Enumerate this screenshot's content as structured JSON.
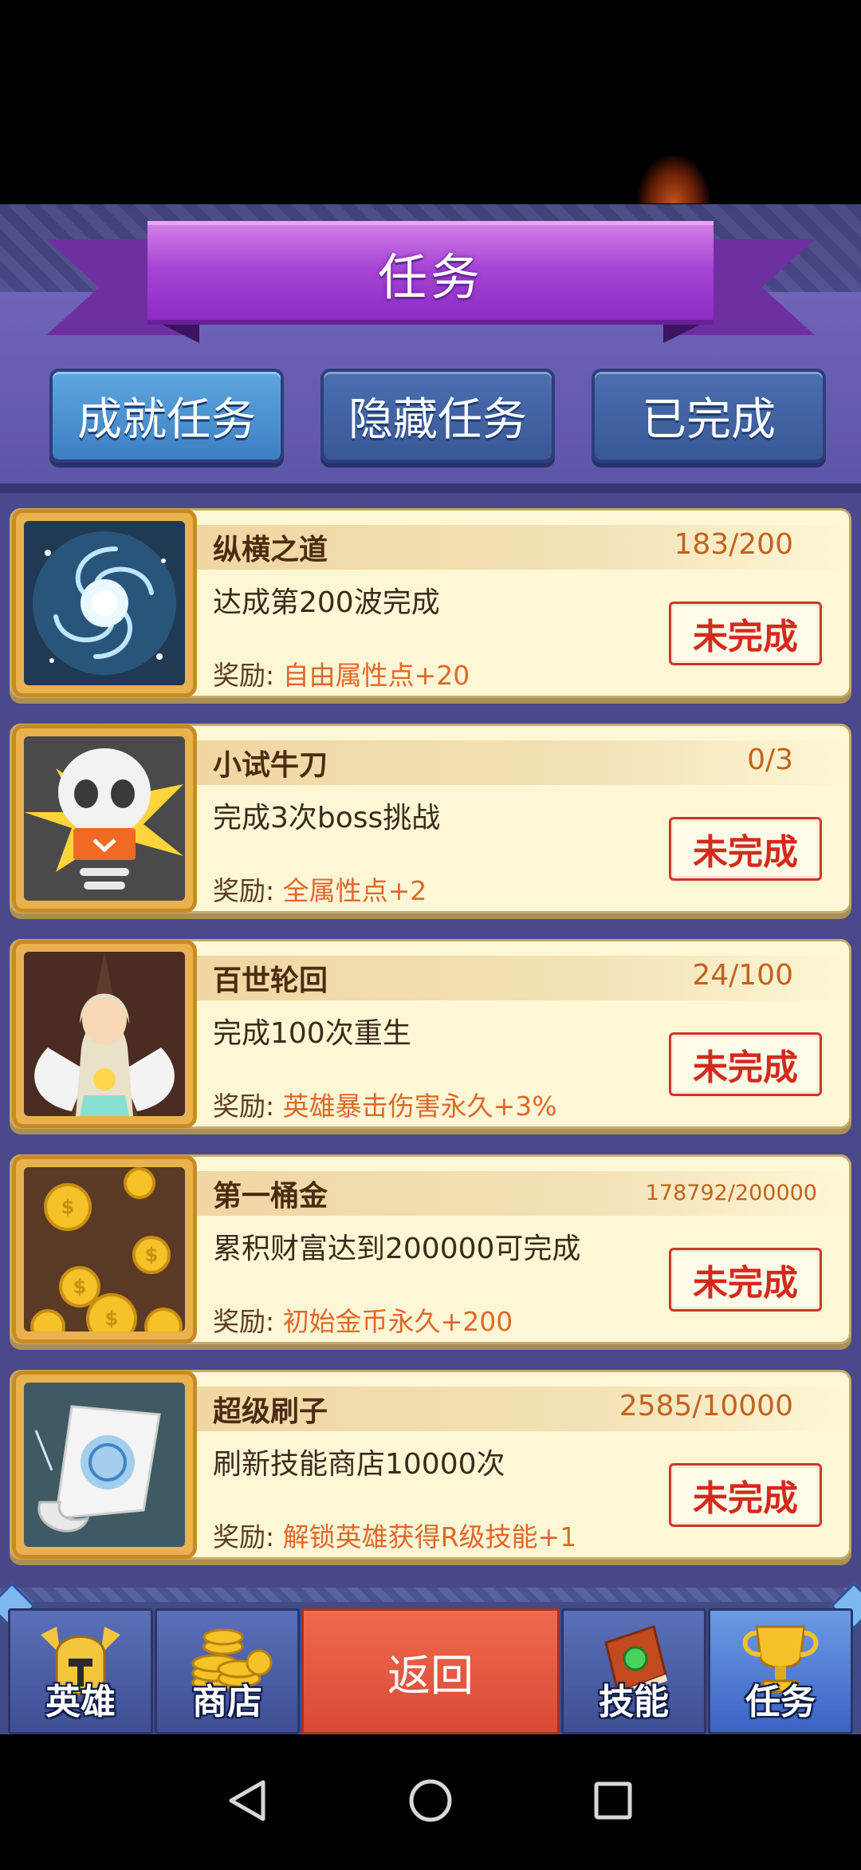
{
  "title": "任务",
  "tabs": [
    {
      "label": "成就任务"
    },
    {
      "label": "隐藏任务"
    },
    {
      "label": "已完成"
    }
  ],
  "tasks": [
    {
      "icon": "galaxy-swirl-icon",
      "name": "纵横之道",
      "progress": "183/200",
      "desc": "达成第200波完成",
      "reward_label": "奖励:",
      "reward_value": "自由属性点+20",
      "status": "未完成"
    },
    {
      "icon": "skull-boss-icon",
      "name": "小试牛刀",
      "progress": "0/3",
      "desc": "完成3次boss挑战",
      "reward_label": "奖励:",
      "reward_value": "全属性点+2",
      "status": "未完成"
    },
    {
      "icon": "angel-hero-icon",
      "name": "百世轮回",
      "progress": "24/100",
      "desc": "完成100次重生",
      "reward_label": "奖励:",
      "reward_value": "英雄暴击伤害永久+3%",
      "status": "未完成"
    },
    {
      "icon": "gold-coins-icon",
      "name": "第一桶金",
      "progress": "178792/200000",
      "desc": "累积财富达到200000可完成",
      "reward_label": "奖励:",
      "reward_value": "初始金币永久+200",
      "status": "未完成"
    },
    {
      "icon": "scroll-icon",
      "name": "超级刷子",
      "progress": "2585/10000",
      "desc": "刷新技能商店10000次",
      "reward_label": "奖励:",
      "reward_value": "解锁英雄获得R级技能+1",
      "status": "未完成"
    }
  ],
  "bottom_nav": {
    "hero": "英雄",
    "shop": "商店",
    "back": "返回",
    "skill": "技能",
    "task": "任务"
  },
  "colors": {
    "panel": "#4b4a8e",
    "card": "#fdf7d6",
    "status_red": "#d42a1d",
    "reward_orange": "#e0672a",
    "ribbon_purple": "#a645d5"
  }
}
